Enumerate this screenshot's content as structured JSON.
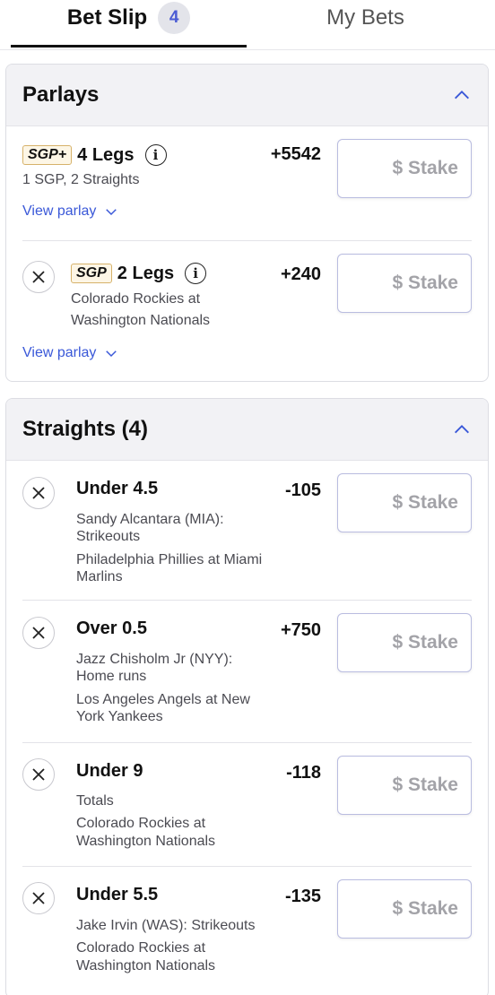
{
  "tabs": {
    "bet_slip": {
      "label": "Bet Slip",
      "count": "4"
    },
    "my_bets": {
      "label": "My Bets"
    }
  },
  "parlays": {
    "title": "Parlays",
    "items": [
      {
        "badge": "SGP+",
        "legs": "4 Legs",
        "desc": "1 SGP, 2 Straights",
        "odds": "+5542",
        "stake_placeholder": "$ Stake",
        "view": "View parlay",
        "info": "i"
      },
      {
        "badge": "SGP",
        "legs": "2 Legs",
        "desc_line1": "Colorado Rockies at",
        "desc_line2": "Washington Nationals",
        "odds": "+240",
        "stake_placeholder": "$ Stake",
        "view": "View parlay",
        "info": "i"
      }
    ]
  },
  "straights": {
    "title": "Straights (4)",
    "items": [
      {
        "pick": "Under 4.5",
        "odds": "-105",
        "market1": "Sandy Alcantara (MIA):",
        "market2": "Strikeouts",
        "game1": "Philadelphia Phillies at Miami",
        "game2": "Marlins",
        "stake_placeholder": "$ Stake"
      },
      {
        "pick": "Over 0.5",
        "odds": "+750",
        "market1": "Jazz Chisholm Jr (NYY):",
        "market2": "Home runs",
        "game1": "Los Angeles Angels at New",
        "game2": "York Yankees",
        "stake_placeholder": "$ Stake"
      },
      {
        "pick": "Under 9",
        "odds": "-118",
        "market1": "Totals",
        "game1": "Colorado Rockies at",
        "game2": "Washington Nationals",
        "stake_placeholder": "$ Stake"
      },
      {
        "pick": "Under 5.5",
        "odds": "-135",
        "market1": "Jake Irvin (WAS): Strikeouts",
        "game1": "Colorado Rockies at",
        "game2": "Washington Nationals",
        "stake_placeholder": "$ Stake"
      }
    ]
  },
  "colors": {
    "accent": "#3a58d8",
    "sgp_border": "#d6b26a",
    "badge_bg": "#e3e4ea"
  }
}
